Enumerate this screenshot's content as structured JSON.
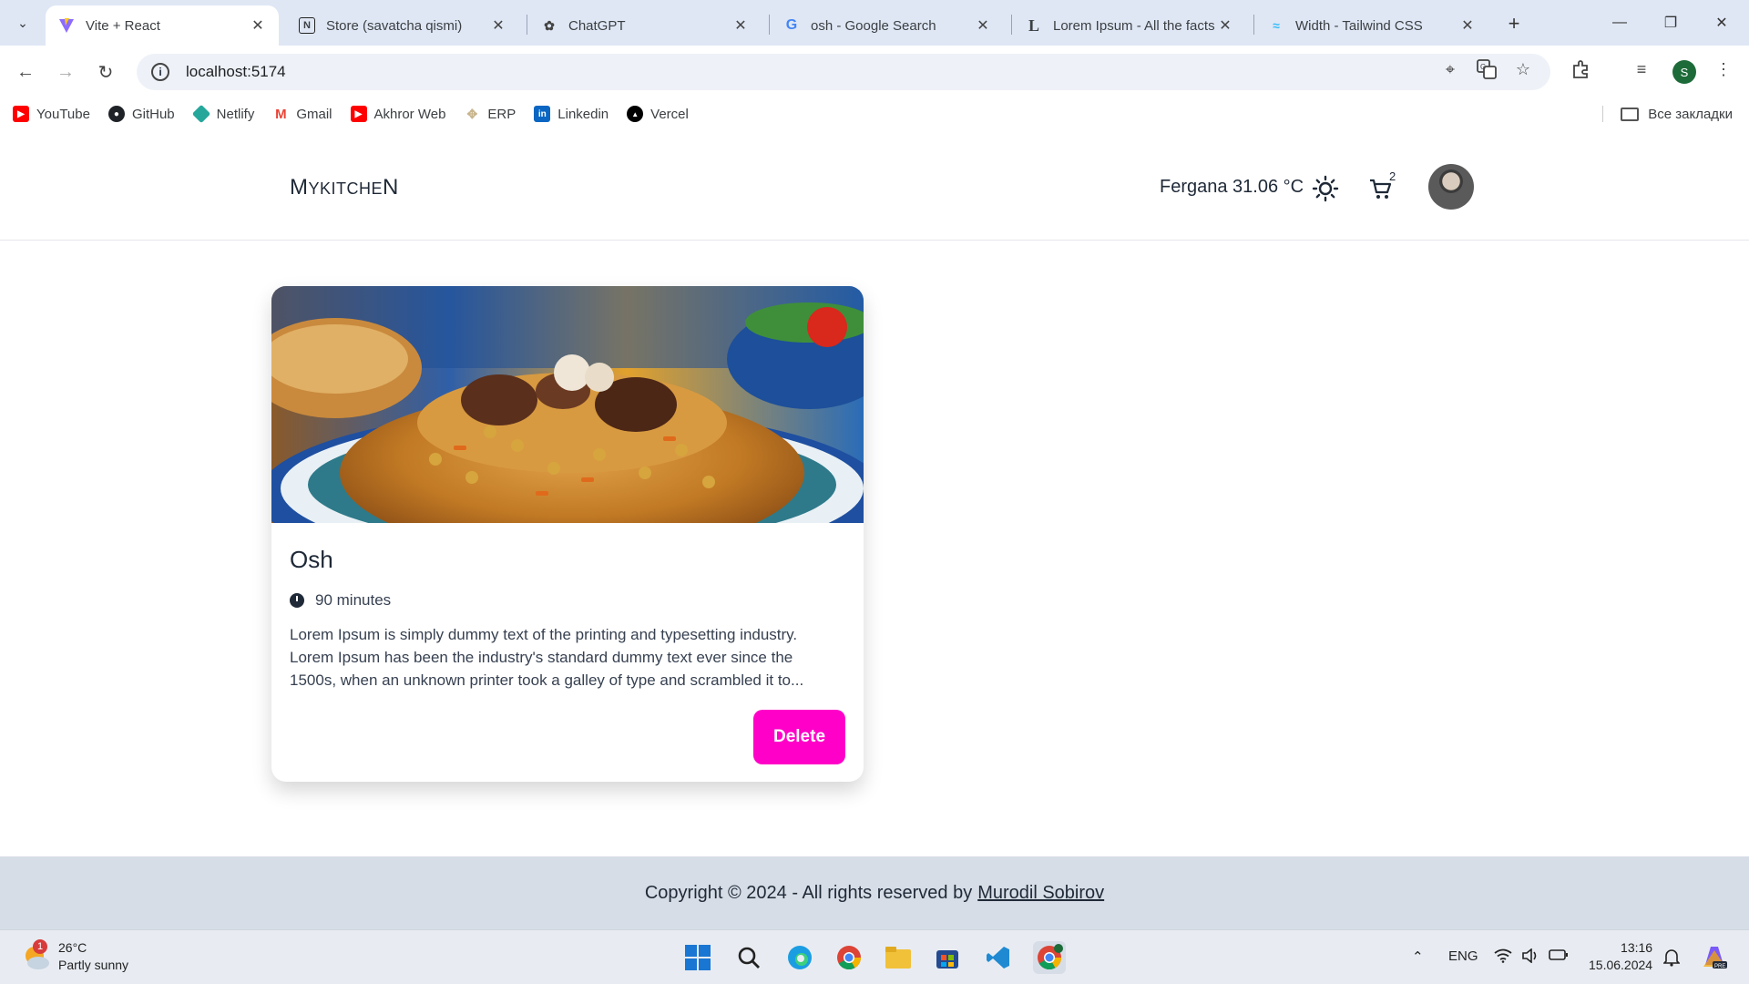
{
  "browser": {
    "tabs": [
      {
        "label": "Vite + React",
        "icon": "vite-icon",
        "active": true
      },
      {
        "label": "Store (savatcha qismi)",
        "icon": "notion-icon",
        "active": false
      },
      {
        "label": "ChatGPT",
        "icon": "chatgpt-icon",
        "active": false
      },
      {
        "label": "osh - Google Search",
        "icon": "google-icon",
        "active": false
      },
      {
        "label": "Lorem Ipsum - All the facts",
        "icon": "lorem-icon",
        "active": false
      },
      {
        "label": "Width - Tailwind CSS",
        "icon": "tailwind-icon",
        "active": false
      }
    ],
    "url": "localhost:5174",
    "profile_initial": "S",
    "bookmarks": [
      {
        "label": "YouTube",
        "icon": "youtube-icon",
        "color": "#ff0000"
      },
      {
        "label": "GitHub",
        "icon": "github-icon",
        "color": "#1f2328"
      },
      {
        "label": "Netlify",
        "icon": "netlify-icon",
        "color": "#25a79b"
      },
      {
        "label": "Gmail",
        "icon": "gmail-icon",
        "color": "#ea4335"
      },
      {
        "label": "Akhror Web",
        "icon": "youtube-icon",
        "color": "#ff0000"
      },
      {
        "label": "ERP",
        "icon": "erp-icon",
        "color": "#d8c8a6"
      },
      {
        "label": "Linkedin",
        "icon": "linkedin-icon",
        "color": "#0a66c2"
      },
      {
        "label": "Vercel",
        "icon": "vercel-icon",
        "color": "#000000"
      }
    ],
    "all_bookmarks": "Все закладки"
  },
  "app": {
    "logo_first": "M",
    "logo_middle": "YKITCHE",
    "logo_last": "N",
    "weather": "Fergana 31.06 °C",
    "cart_count": "2",
    "accent_color": "#ff00c8"
  },
  "recipe": {
    "title": "Osh",
    "time": "90 minutes",
    "description": "Lorem Ipsum is simply dummy text of the printing and typesetting industry. Lorem Ipsum has been the industry's standard dummy text ever since the 1500s, when an unknown printer took a galley of type and scrambled it to...",
    "delete_label": "Delete"
  },
  "footer": {
    "text": "Copyright © 2024 - All rights reserved by",
    "author": "Murodil Sobirov"
  },
  "taskbar": {
    "temperature": "26°C",
    "condition": "Partly sunny",
    "weather_badge": "1",
    "lang": "ENG",
    "time": "13:16",
    "date": "15.06.2024"
  }
}
